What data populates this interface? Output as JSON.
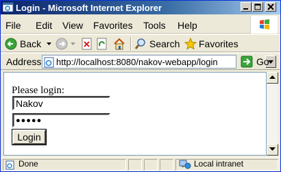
{
  "window": {
    "title": "Login - Microsoft Internet Explorer"
  },
  "menu": [
    "File",
    "Edit",
    "View",
    "Favorites",
    "Tools",
    "Help"
  ],
  "toolbar": {
    "back_label": "Back",
    "search_label": "Search",
    "favorites_label": "Favorites"
  },
  "address": {
    "label": "Address",
    "url": "http://localhost:8080/nakov-webapp/login",
    "go_label": "Go"
  },
  "page": {
    "prompt": "Please login:",
    "username": "Nakov",
    "password_mask": "●●●●●",
    "login_button": "Login"
  },
  "status": {
    "text": "Done",
    "zone": "Local intranet"
  },
  "colors": {
    "titlebar": "#0a246a",
    "chrome": "#ece9d8"
  }
}
